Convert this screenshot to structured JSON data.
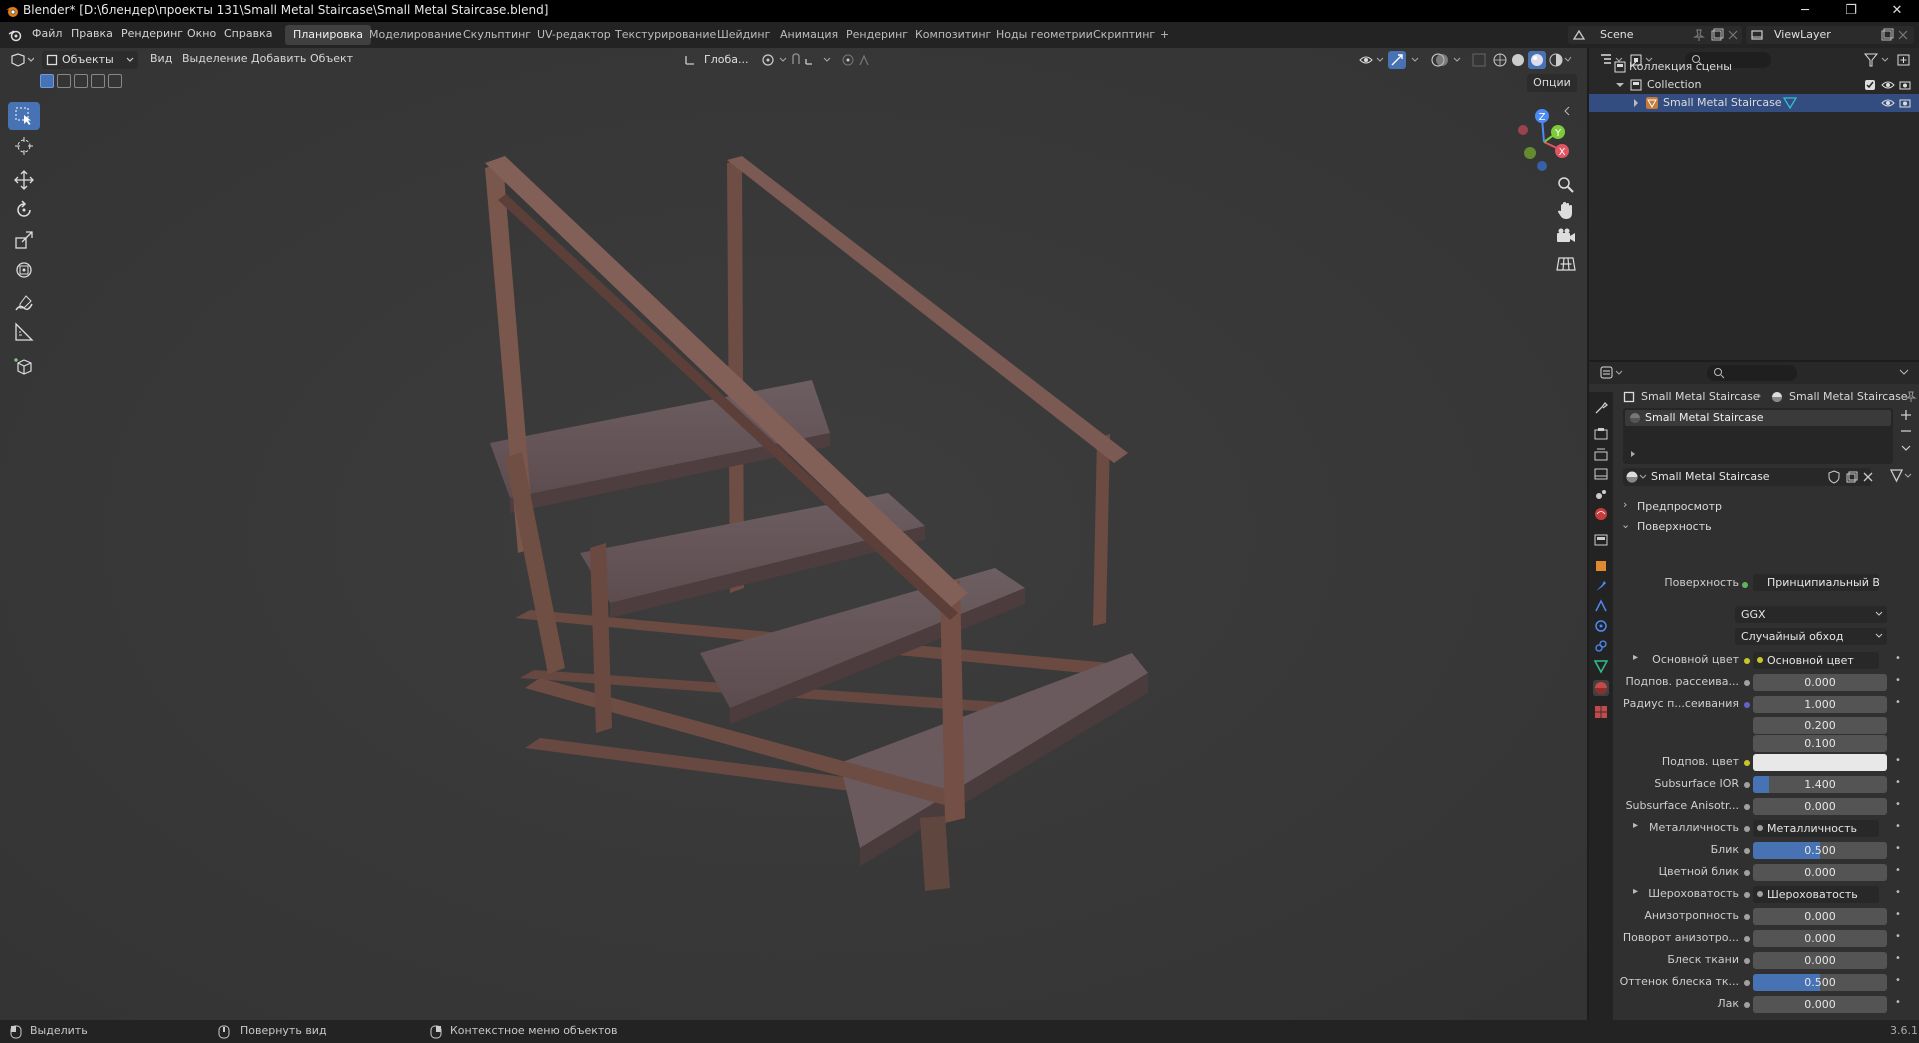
{
  "window": {
    "title": "Blender* [D:\\блендер\\проекты 131\\Small Metal Staircase\\Small Metal Staircase.blend]",
    "minimize": "─",
    "restore": "❐",
    "close": "✕"
  },
  "menu": [
    "Файл",
    "Правка",
    "Рендеринг",
    "Окно",
    "Справка"
  ],
  "workspaces": [
    "Планировка",
    "Моделирование",
    "Скульптинг",
    "UV-редактор",
    "Текстурирование",
    "Шейдинг",
    "Анимация",
    "Рендеринг",
    "Композитинг",
    "Ноды геометрии",
    "Скриптинг",
    "+"
  ],
  "active_workspace": "Планировка",
  "scene": {
    "name": "Scene",
    "view_layer": "ViewLayer"
  },
  "viewport": {
    "mode": "Объекты",
    "menus": [
      "Вид",
      "Выделение",
      "Добавить",
      "Объект"
    ],
    "orientation": "Глоба...",
    "options_label": "Опции",
    "gizmo_axes": [
      "X",
      "Y",
      "Z"
    ],
    "accent": "#4772b3"
  },
  "toolbar": {
    "tools": [
      "select-box",
      "cursor",
      "move",
      "rotate",
      "scale",
      "transform",
      "annotate",
      "measure",
      "add-cube"
    ],
    "active": "select-box"
  },
  "outliner": {
    "root": "Коллекция сцены",
    "collection": "Collection",
    "object": "Small Metal Staircase"
  },
  "properties": {
    "breadcrumb_object": "Small Metal Staircase",
    "breadcrumb_material": "Small Metal Staircase",
    "material_slot": "Small Metal Staircase",
    "material_name": "Small Metal Staircase",
    "sections": {
      "preview": "Предпросмотр",
      "surface": "Поверхность"
    },
    "surface_label": "Поверхность",
    "surface_value": "Принципиальный BSDF",
    "distribution": "GGX",
    "subsurface_method": "Случайный обход",
    "rows": [
      {
        "label": "Основной цвет",
        "value": "Основной цвет",
        "kind": "link",
        "expand": true
      },
      {
        "label": "Подпов. рассеива...",
        "value": "0.000",
        "kind": "num",
        "fill": 0
      },
      {
        "label": "Радиус п...сеивания",
        "value": "1.000",
        "kind": "num",
        "fill": 0
      },
      {
        "label": "",
        "value": "0.200",
        "kind": "num",
        "fill": 0
      },
      {
        "label": "",
        "value": "0.100",
        "kind": "num",
        "fill": 0
      },
      {
        "label": "Подпов. цвет",
        "value": "",
        "kind": "color"
      },
      {
        "label": "Subsurface IOR",
        "value": "1.400",
        "kind": "num",
        "fill": 0.12
      },
      {
        "label": "Subsurface Anisotr...",
        "value": "0.000",
        "kind": "num",
        "fill": 0
      },
      {
        "label": "Металличность",
        "value": "Металличность",
        "kind": "link",
        "expand": true
      },
      {
        "label": "Блик",
        "value": "0.500",
        "kind": "num",
        "fill": 0.5
      },
      {
        "label": "Цветной блик",
        "value": "0.000",
        "kind": "num",
        "fill": 0
      },
      {
        "label": "Шероховатость",
        "value": "Шероховатость",
        "kind": "link",
        "expand": true
      },
      {
        "label": "Анизотропность",
        "value": "0.000",
        "kind": "num",
        "fill": 0
      },
      {
        "label": "Поворот анизотро...",
        "value": "0.000",
        "kind": "num",
        "fill": 0
      },
      {
        "label": "Блеск ткани",
        "value": "0.000",
        "kind": "num",
        "fill": 0
      },
      {
        "label": "Оттенок блеска тк...",
        "value": "0.500",
        "kind": "num",
        "fill": 0.5
      },
      {
        "label": "Лак",
        "value": "0.000",
        "kind": "num",
        "fill": 0
      }
    ]
  },
  "statusbar": {
    "select": "Выделить",
    "rotate_view": "Повернуть вид",
    "context_menu": "Контекстное меню объектов",
    "version": "3.6.1"
  }
}
